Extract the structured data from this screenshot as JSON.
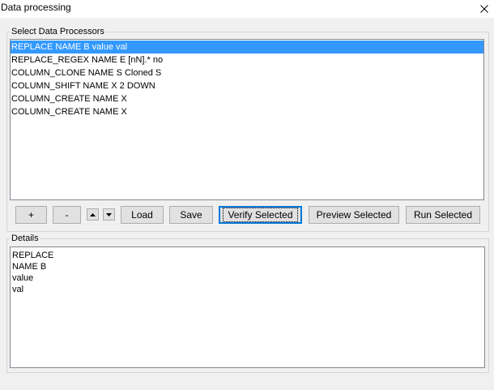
{
  "window": {
    "title": "Data processing",
    "close_icon": "close-icon"
  },
  "processors": {
    "legend": "Select Data Processors",
    "items": [
      "REPLACE NAME B value val",
      "REPLACE_REGEX NAME E [nN].* no",
      "COLUMN_CLONE NAME S Cloned S",
      "COLUMN_SHIFT NAME X 2 DOWN",
      "COLUMN_CREATE NAME X",
      "COLUMN_CREATE NAME X"
    ],
    "selected_index": 0
  },
  "toolbar": {
    "add_label": "+",
    "remove_label": "-",
    "up_icon": "triangle-up-icon",
    "down_icon": "triangle-down-icon",
    "load_label": "Load",
    "save_label": "Save",
    "verify_label": "Verify Selected",
    "preview_label": "Preview Selected",
    "run_label": "Run Selected"
  },
  "details": {
    "legend": "Details",
    "lines": [
      "REPLACE",
      "NAME B",
      "value",
      "val"
    ]
  },
  "colors": {
    "selection": "#3399ff",
    "focus": "#0078d7",
    "window_bg": "#f0f0f0"
  }
}
